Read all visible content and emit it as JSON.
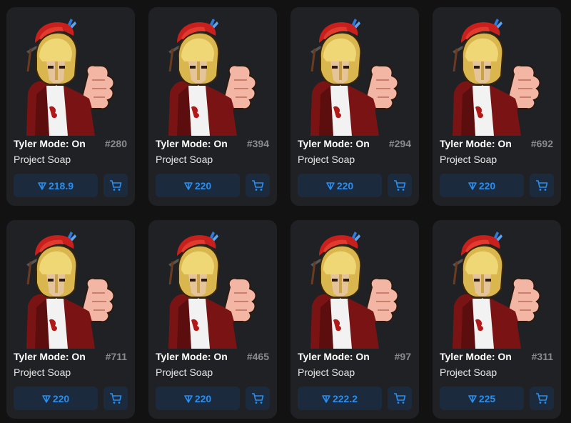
{
  "colors": {
    "page_background": "#121212",
    "card_background": "#202124",
    "button_background": "#1b2a3c",
    "accent_blue": "#2a8ef0",
    "title_text": "#ffffff",
    "muted_number": "#8a8a8f"
  },
  "icons": {
    "currency": "ton-diamond-icon",
    "cart": "shopping-cart-icon"
  },
  "cards": [
    {
      "title": "Tyler Mode: On",
      "number": "#280",
      "collection": "Project Soap",
      "price": "218.9"
    },
    {
      "title": "Tyler Mode: On",
      "number": "#394",
      "collection": "Project Soap",
      "price": "220"
    },
    {
      "title": "Tyler Mode: On",
      "number": "#294",
      "collection": "Project Soap",
      "price": "220"
    },
    {
      "title": "Tyler Mode: On",
      "number": "#692",
      "collection": "Project Soap",
      "price": "220"
    },
    {
      "title": "Tyler Mode: On",
      "number": "#711",
      "collection": "Project Soap",
      "price": "220"
    },
    {
      "title": "Tyler Mode: On",
      "number": "#465",
      "collection": "Project Soap",
      "price": "220"
    },
    {
      "title": "Tyler Mode: On",
      "number": "#97",
      "collection": "Project Soap",
      "price": "222.2"
    },
    {
      "title": "Tyler Mode: On",
      "number": "#311",
      "collection": "Project Soap",
      "price": "225"
    }
  ]
}
